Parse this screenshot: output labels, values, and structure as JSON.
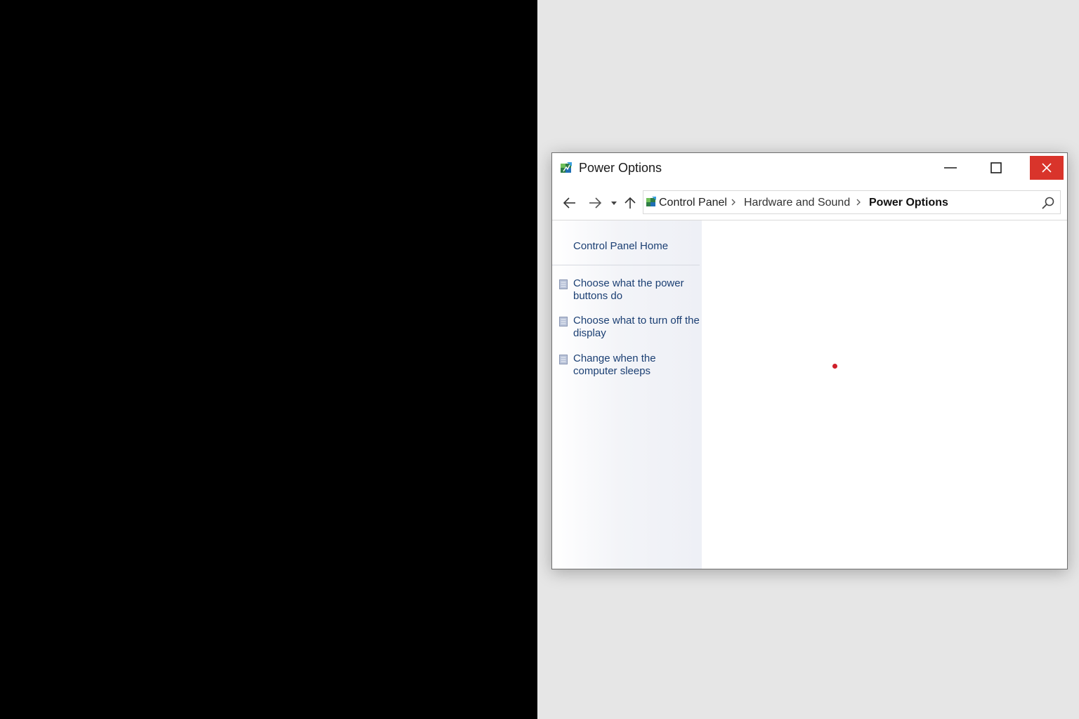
{
  "window": {
    "title": "Power Options"
  },
  "title_buttons": {
    "minimize_icon": "minimize-icon",
    "maximize_icon": "maximize-icon",
    "close_icon": "close-icon",
    "close_color": "#d9342b"
  },
  "navigation": {
    "back_icon": "arrow-left-icon",
    "forward_icon": "arrow-right-icon",
    "recent_icon": "chevron-down-icon",
    "up_icon": "arrow-up-icon"
  },
  "address_bar": {
    "breadcrumbs": [
      {
        "label": "Control Panel"
      },
      {
        "label": "Hardware and Sound"
      },
      {
        "label": "Power Options"
      }
    ],
    "search_icon": "search-icon"
  },
  "sidebar": {
    "home_label": "Control Panel Home",
    "links": [
      {
        "label": "Choose what the power buttons do"
      },
      {
        "label": "Choose what to turn off the display"
      },
      {
        "label": "Change when the computer sleeps"
      }
    ]
  },
  "colors": {
    "link": "#1b3f73",
    "close_button": "#d9342b",
    "indicator_dot": "#cf1f2a"
  }
}
